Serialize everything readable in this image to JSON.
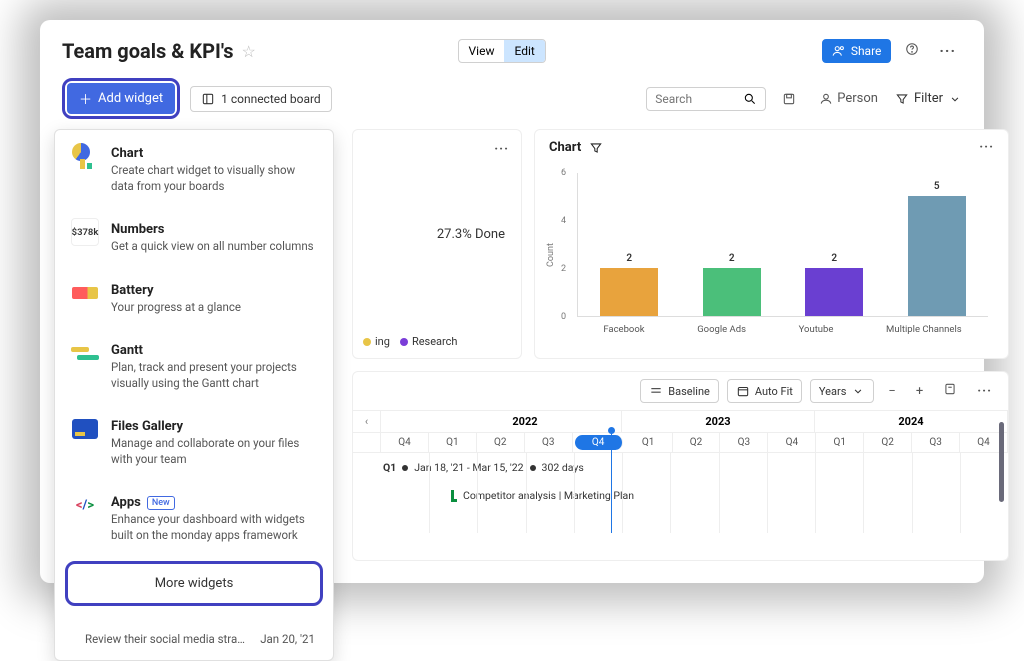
{
  "header": {
    "title": "Team goals & KPI's",
    "view_label": "View",
    "edit_label": "Edit",
    "share_label": "Share"
  },
  "toolbar": {
    "add_widget": "Add widget",
    "connected_boards": "1 connected board",
    "search_placeholder": "Search",
    "person_label": "Person",
    "filter_label": "Filter"
  },
  "widget_menu": {
    "items": [
      {
        "title": "Chart",
        "desc": "Create chart widget to visually show data from your boards",
        "icon": "chart"
      },
      {
        "title": "Numbers",
        "desc": "Get a quick view on all number columns",
        "icon": "numbers",
        "icon_text": "$378k"
      },
      {
        "title": "Battery",
        "desc": "Your progress at a glance",
        "icon": "battery"
      },
      {
        "title": "Gantt",
        "desc": "Plan, track and present your projects visually using the Gantt chart",
        "icon": "gantt"
      },
      {
        "title": "Files Gallery",
        "desc": "Manage and collaborate on your files with your team",
        "icon": "files"
      },
      {
        "title": "Apps",
        "desc": "Enhance your dashboard with widgets built on the monday apps framework",
        "icon": "apps",
        "badge": "New"
      }
    ],
    "more": "More widgets",
    "review_text": "Review their social media stra…",
    "review_date": "Jan 20, '21"
  },
  "pie_card": {
    "done_text": "27.3% Done",
    "legend": [
      {
        "label": "ing",
        "color": "#e8c547"
      },
      {
        "label": "Research",
        "color": "#7a3dd8"
      }
    ]
  },
  "chart_card": {
    "title": "Chart"
  },
  "chart_data": {
    "type": "bar",
    "title": "",
    "ylabel": "Count",
    "ylim": [
      0,
      6
    ],
    "yticks": [
      0,
      2,
      4,
      6
    ],
    "categories": [
      "Facebook",
      "Google Ads",
      "Youtube",
      "Multiple Channels"
    ],
    "values": [
      2,
      2,
      2,
      5
    ],
    "colors": [
      "#e8a33d",
      "#4bbf7a",
      "#6a3fd1",
      "#6f9bb3"
    ]
  },
  "gantt": {
    "baseline_label": "Baseline",
    "autofit_label": "Auto Fit",
    "range_label": "Years",
    "years": [
      "2022",
      "2023",
      "2024"
    ],
    "quarters": [
      "Q4",
      "Q1",
      "Q2",
      "Q3",
      "Q4",
      "Q1",
      "Q2",
      "Q3",
      "Q4",
      "Q1",
      "Q2",
      "Q3",
      "Q4"
    ],
    "active_quarter_index": 4,
    "row1_label": "Q1",
    "row1_dates": "Jan 18, '21 - Mar 15, '22",
    "row1_days": "302 days",
    "task1": "Competitor analysis | Marketing Plan"
  }
}
